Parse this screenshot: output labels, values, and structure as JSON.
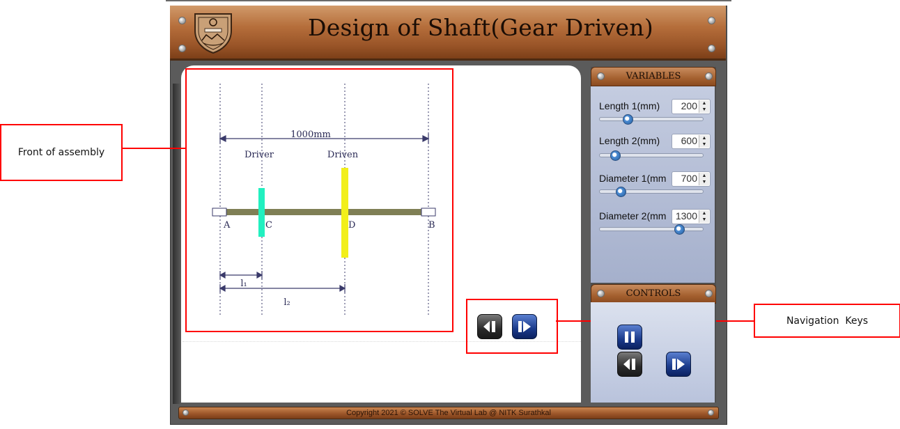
{
  "header": {
    "title": "Design of Shaft(Gear Driven)"
  },
  "diagram": {
    "span_label": "1000mm",
    "driver_label": "Driver",
    "driven_label": "Driven",
    "point_a": "A",
    "point_c": "C",
    "point_d": "D",
    "point_b": "B",
    "l1_label": "l₁",
    "l2_label": "l₂",
    "colors": {
      "shaft": "#7f7f55",
      "driver_gear": "#22f0c0",
      "driven_gear": "#f2ef1a",
      "dim_line": "#3a3a6a"
    }
  },
  "annotations": {
    "front_of_assembly": "Front of assembly",
    "navigation_keys": "Navigation  Keys"
  },
  "variables": {
    "header": "VARIABLES",
    "items": [
      {
        "label": "Length 1(mm)",
        "value": "200",
        "slider_level": 0.25
      },
      {
        "label": "Length 2(mm)",
        "value": "600",
        "slider_level": 0.12
      },
      {
        "label": "Diameter 1(mm",
        "value": "700",
        "slider_level": 0.18
      },
      {
        "label": "Diameter 2(mm",
        "value": "1300",
        "slider_level": 0.8
      }
    ]
  },
  "controls": {
    "header": "CONTROLS"
  },
  "footer": {
    "copyright": "Copyright 2021 © SOLVE The Virtual Lab @ NITK Surathkal"
  },
  "icons": {
    "prev": "skip-back-icon",
    "next": "play-next-icon",
    "pause": "pause-icon",
    "logo": "nitk-emblem-icon",
    "spinner": "spinner-arrows-icon"
  }
}
